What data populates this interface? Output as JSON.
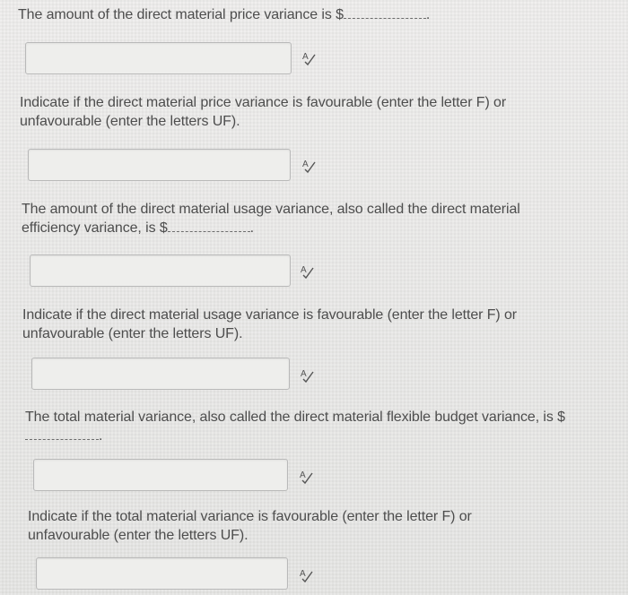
{
  "questions": [
    {
      "text": "The amount of the direct material price variance is $",
      "suffix": ".",
      "answer_value": ""
    },
    {
      "text": "Indicate if the direct material price variance is favourable (enter the letter F) or unfavourable (enter the letters UF).",
      "answer_value": ""
    },
    {
      "text": "The amount of the direct material usage variance, also called the direct material efficiency variance, is $",
      "suffix": ".",
      "answer_value": ""
    },
    {
      "text": "Indicate if the direct material usage variance is favourable (enter the letter F) or unfavourable (enter the letters UF).",
      "answer_value": ""
    },
    {
      "text": "The total material variance, also called the direct material flexible budget variance, is $",
      "suffix": ".",
      "answer_value": ""
    },
    {
      "text": "Indicate if the total material variance is favourable (enter the letter F) or unfavourable (enter the letters UF).",
      "answer_value": ""
    }
  ],
  "icon": "spell-check-icon"
}
